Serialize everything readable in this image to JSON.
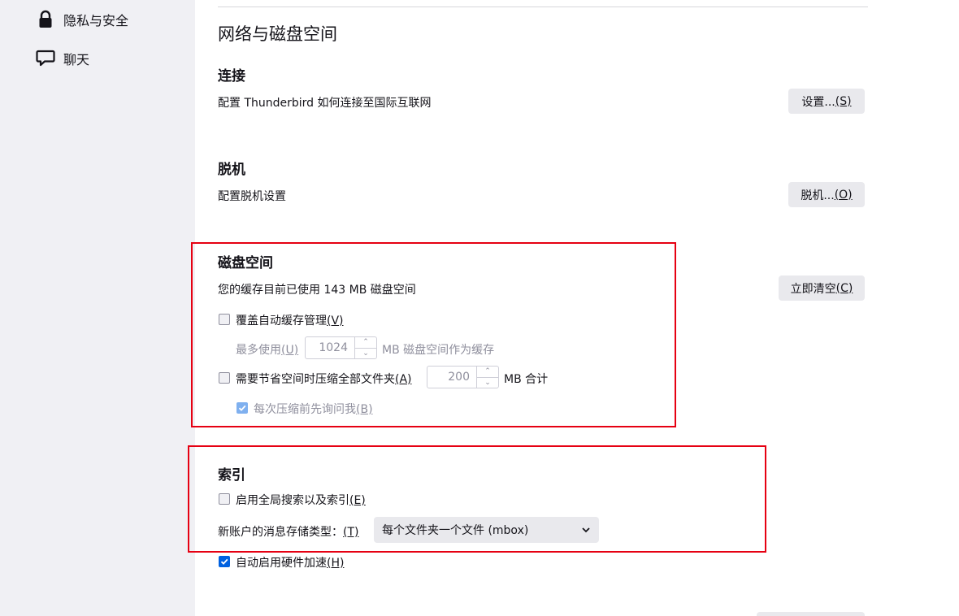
{
  "sidebar": {
    "items": [
      {
        "label": "隐私与安全",
        "icon": "lock-icon"
      },
      {
        "label": "聊天",
        "icon": "chat-bubble-icon"
      }
    ]
  },
  "main": {
    "section_title": "网络与磁盘空间",
    "connection": {
      "heading": "连接",
      "description": "配置 Thunderbird 如何连接至国际互联网",
      "button_label": "设置...",
      "button_accesskey": "(S)"
    },
    "offline": {
      "heading": "脱机",
      "description": "配置脱机设置",
      "button_label": "脱机...",
      "button_accesskey": "(O)"
    },
    "disk_space": {
      "heading": "磁盘空间",
      "description": "您的缓存目前已使用 143 MB 磁盘空间",
      "clear_button_label": "立即清空",
      "clear_button_accesskey": "(C)",
      "override_cache_label": "覆盖自动缓存管理",
      "override_cache_accesskey": "(V)",
      "override_cache_checked": false,
      "max_use_label": "最多使用",
      "max_use_accesskey": "(U)",
      "max_use_value": "1024",
      "max_use_suffix": "MB 磁盘空间作为缓存",
      "compact_label": "需要节省空间时压缩全部文件夹",
      "compact_accesskey": "(A)",
      "compact_checked": false,
      "compact_value": "200",
      "compact_suffix": "MB 合计",
      "ask_before_label": "每次压缩前先询问我",
      "ask_before_accesskey": "(B)",
      "ask_before_checked": true
    },
    "index": {
      "heading": "索引",
      "global_search_label": "启用全局搜索以及索引",
      "global_search_accesskey": "(E)",
      "global_search_checked": false,
      "store_type_label": "新账户的消息存储类型：",
      "store_type_accesskey": "(T)",
      "store_type_value": "每个文件夹一个文件 (mbox)"
    },
    "hardware_accel": {
      "label": "自动启用硬件加速",
      "accesskey": "(H)",
      "checked": true
    }
  },
  "colors": {
    "highlight_box": "#e60012",
    "accent": "#0061e0",
    "sidebar_bg": "#f0f0f4",
    "button_bg": "#e9e9ed"
  }
}
